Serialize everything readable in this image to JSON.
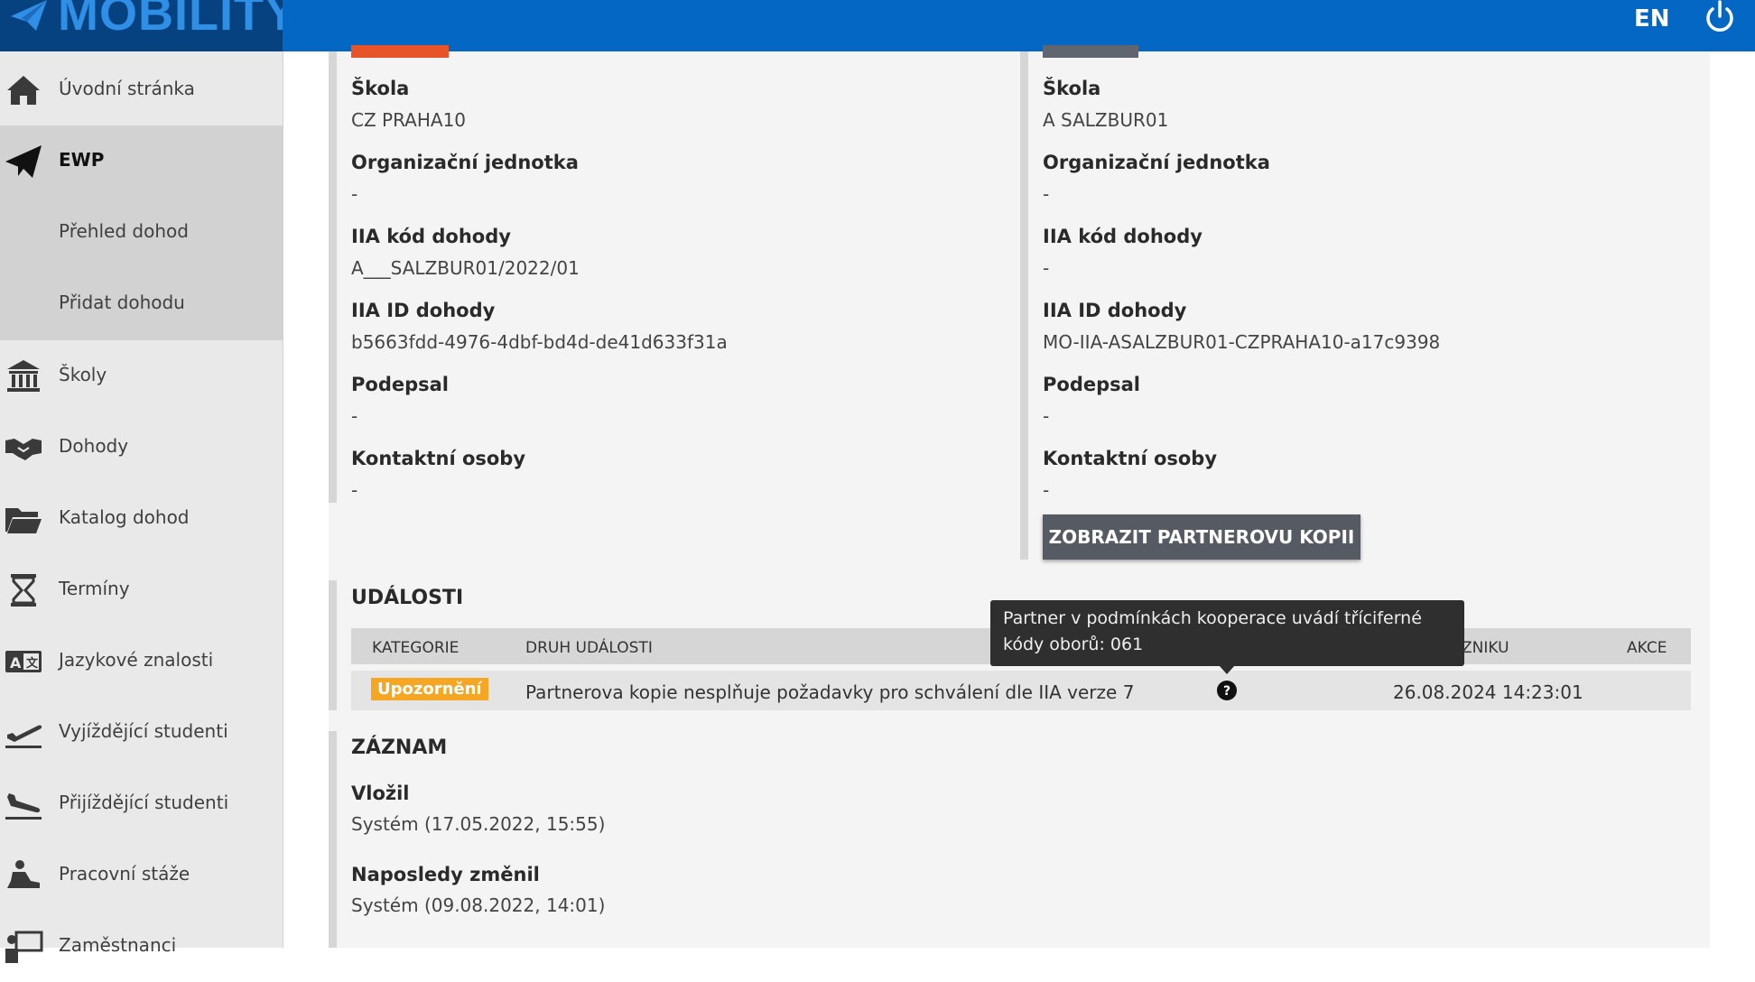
{
  "app": {
    "logo_text": "MOBILITY",
    "language": "EN"
  },
  "colors": {
    "topbar": "#0567c4",
    "logo_bg": "#06427f",
    "warning": "#f5a623",
    "button": "#555a63"
  },
  "sidebar": {
    "items": [
      {
        "label": "Úvodní stránka",
        "icon": "home-icon"
      },
      {
        "label": "EWP",
        "icon": "paper-plane-icon",
        "active": true
      },
      {
        "label": "Přehled dohod",
        "sub": true
      },
      {
        "label": "Přidat dohodu",
        "sub": true
      },
      {
        "label": "Školy",
        "icon": "bank-icon"
      },
      {
        "label": "Dohody",
        "icon": "handshake-icon"
      },
      {
        "label": "Katalog dohod",
        "icon": "folder-open-icon"
      },
      {
        "label": "Termíny",
        "icon": "hourglass-icon"
      },
      {
        "label": "Jazykové znalosti",
        "icon": "language-icon"
      },
      {
        "label": "Vyjíždějící studenti",
        "icon": "plane-departure-icon"
      },
      {
        "label": "Přijíždějící studenti",
        "icon": "plane-arrival-icon"
      },
      {
        "label": "Pracovní stáže",
        "icon": "worker-icon"
      },
      {
        "label": "Zaměstnanci",
        "icon": "teacher-icon"
      }
    ]
  },
  "left_panel": {
    "school_label": "Škola",
    "school": "CZ PRAHA10",
    "unit_label": "Organizační jednotka",
    "unit": "-",
    "code_label": "IIA kód dohody",
    "code": "A___SALZBUR01/2022/01",
    "id_label": "IIA ID dohody",
    "id": "b5663fdd-4976-4dbf-bd4d-de41d633f31a",
    "signed_label": "Podepsal",
    "signed": "-",
    "contacts_label": "Kontaktní osoby",
    "contacts": "-"
  },
  "right_panel": {
    "school_label": "Škola",
    "school": "A SALZBUR01",
    "unit_label": "Organizační jednotka",
    "unit": "-",
    "code_label": "IIA kód dohody",
    "code": "-",
    "id_label": "IIA ID dohody",
    "id": "MO-IIA-ASALZBUR01-CZPRAHA10-a17c9398",
    "signed_label": "Podepsal",
    "signed": "-",
    "contacts_label": "Kontaktní osoby",
    "contacts": "-",
    "partner_copy_button": "ZOBRAZIT PARTNEROVU KOPII"
  },
  "events": {
    "title": "UDÁLOSTI",
    "columns": {
      "category": "KATEGORIE",
      "type": "DRUH UDÁLOSTI",
      "created": "ZNIKU",
      "actions": "AKCE"
    },
    "rows": [
      {
        "category": "Upozornění",
        "type": "Partnerova kopie nesplňuje požadavky pro schválení dle IIA verze 7",
        "created": "26.08.2024 14:23:01"
      }
    ],
    "tooltip": "Partner v podmínkách kooperace uvádí tříciferné kódy oborů: 061"
  },
  "record": {
    "title": "ZÁZNAM",
    "inserted_label": "Vložil",
    "inserted": "Systém (17.05.2022, 15:55)",
    "changed_label": "Naposledy změnil",
    "changed": "Systém (09.08.2022, 14:01)"
  }
}
